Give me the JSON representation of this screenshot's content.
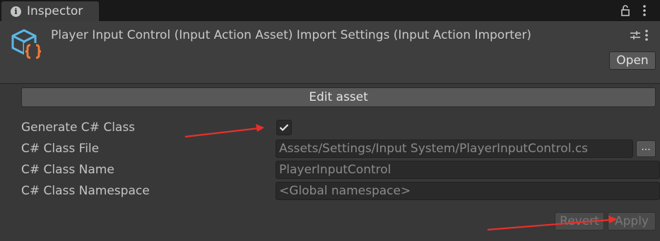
{
  "tab": {
    "title": "Inspector"
  },
  "header": {
    "title": "Player Input Control (Input Action Asset) Import Settings (Input Action Importer)",
    "open_label": "Open"
  },
  "main": {
    "edit_asset_label": "Edit asset",
    "rows": [
      {
        "label": "Generate C# Class",
        "checked": true
      },
      {
        "label": "C# Class File",
        "value": "Assets/Settings/Input System/PlayerInputControl.cs",
        "browse_label": "..."
      },
      {
        "label": "C# Class Name",
        "value": "PlayerInputControl"
      },
      {
        "label": "C# Class Namespace",
        "placeholder": "<Global namespace>"
      }
    ],
    "revert_label": "Revert",
    "apply_label": "Apply"
  },
  "colors": {
    "annotation_arrow": "#e8302a",
    "asset_icon_cube": "#5ab8e8",
    "asset_icon_braces": "#f07a3a"
  },
  "icons": [
    "info-icon",
    "lock-icon",
    "kebab-menu-icon",
    "input-action-asset-icon",
    "preset-settings-icon",
    "checkmark-icon"
  ]
}
